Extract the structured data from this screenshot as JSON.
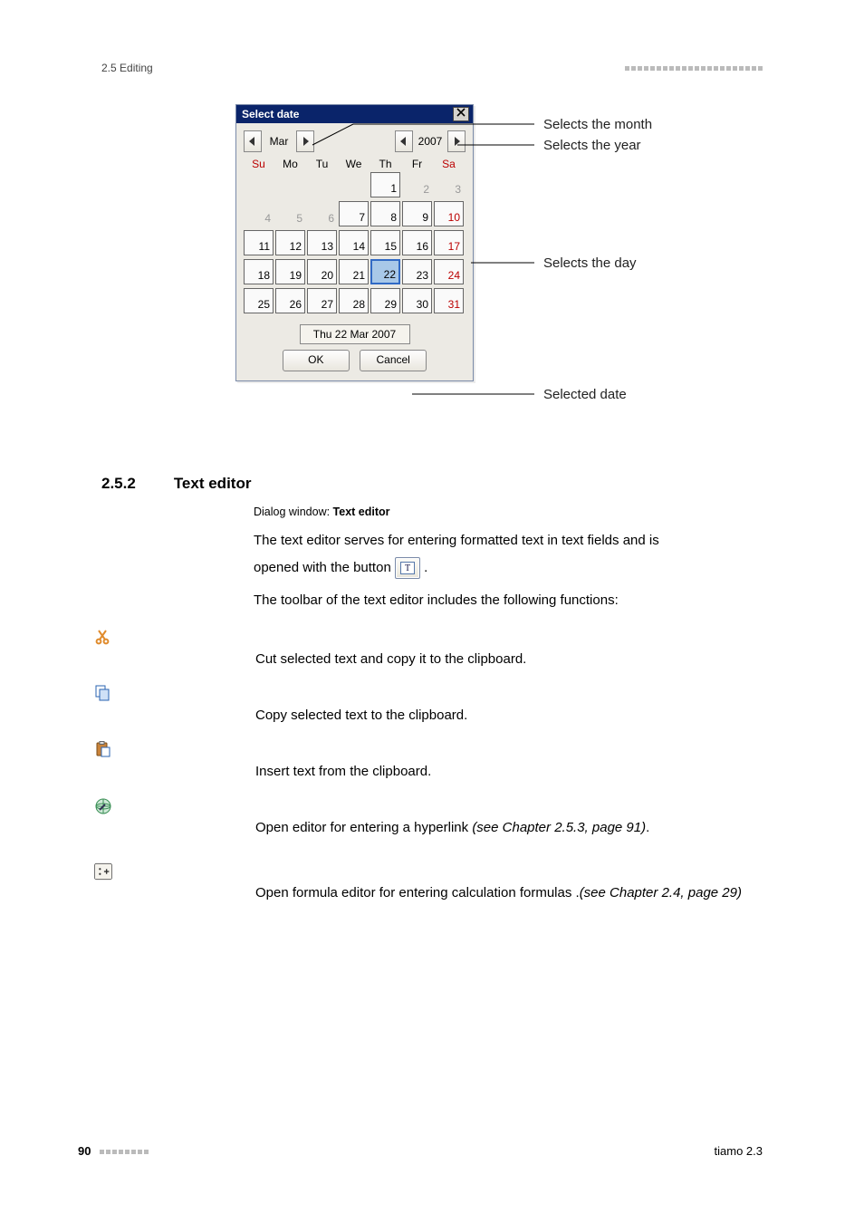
{
  "header": {
    "section_label": "2.5 Editing"
  },
  "dialog": {
    "title": "Select date",
    "month": "Mar",
    "year": "2007",
    "dow": [
      "Su",
      "Mo",
      "Tu",
      "We",
      "Th",
      "Fr",
      "Sa"
    ],
    "weeks": [
      [
        {
          "n": "",
          "a": false,
          "we": false
        },
        {
          "n": "",
          "a": false,
          "we": false
        },
        {
          "n": "",
          "a": false,
          "we": false
        },
        {
          "n": "",
          "a": false,
          "we": false
        },
        {
          "n": "1",
          "a": true,
          "we": false
        },
        {
          "n": "2",
          "a": false,
          "we": false
        },
        {
          "n": "3",
          "a": false,
          "we": true
        }
      ],
      [
        {
          "n": "4",
          "a": false,
          "we": false
        },
        {
          "n": "5",
          "a": false,
          "we": false
        },
        {
          "n": "6",
          "a": false,
          "we": false
        },
        {
          "n": "7",
          "a": true,
          "we": false
        },
        {
          "n": "8",
          "a": true,
          "we": false
        },
        {
          "n": "9",
          "a": true,
          "we": false
        },
        {
          "n": "10",
          "a": true,
          "we": true
        }
      ],
      [
        {
          "n": "11",
          "a": true,
          "we": false
        },
        {
          "n": "12",
          "a": true,
          "we": false
        },
        {
          "n": "13",
          "a": true,
          "we": false
        },
        {
          "n": "14",
          "a": true,
          "we": false
        },
        {
          "n": "15",
          "a": true,
          "we": false
        },
        {
          "n": "16",
          "a": true,
          "we": false
        },
        {
          "n": "17",
          "a": true,
          "we": true
        }
      ],
      [
        {
          "n": "18",
          "a": true,
          "we": false
        },
        {
          "n": "19",
          "a": true,
          "we": false
        },
        {
          "n": "20",
          "a": true,
          "we": false
        },
        {
          "n": "21",
          "a": true,
          "we": false
        },
        {
          "n": "22",
          "a": true,
          "we": false,
          "sel": true
        },
        {
          "n": "23",
          "a": true,
          "we": false
        },
        {
          "n": "24",
          "a": true,
          "we": true
        }
      ],
      [
        {
          "n": "25",
          "a": true,
          "we": false
        },
        {
          "n": "26",
          "a": true,
          "we": false
        },
        {
          "n": "27",
          "a": true,
          "we": false
        },
        {
          "n": "28",
          "a": true,
          "we": false
        },
        {
          "n": "29",
          "a": true,
          "we": false
        },
        {
          "n": "30",
          "a": true,
          "we": false
        },
        {
          "n": "31",
          "a": true,
          "we": true
        }
      ]
    ],
    "selected_date_display": "Thu  22 Mar 2007",
    "ok_label": "OK",
    "cancel_label": "Cancel"
  },
  "callouts": {
    "month": "Selects the month",
    "year": "Selects the year",
    "day": "Selects the day",
    "selected": "Selected date"
  },
  "section": {
    "number": "2.5.2",
    "title": "Text editor"
  },
  "body": {
    "dialog_caption_prefix": "Dialog window: ",
    "dialog_caption_name": "Text editor",
    "para1a": "The text editor serves for entering formatted text in text fields and is",
    "para1b_pre": "opened with the button ",
    "para1b_post": ".",
    "para2": "The toolbar of the text editor includes the following functions:"
  },
  "tools": {
    "cut": "Cut selected text and copy it to the clipboard.",
    "copy": "Copy selected text to the clipboard.",
    "paste": "Insert text from the clipboard.",
    "link_pre": "Open editor for entering a hyperlink ",
    "link_ref": "(see Chapter 2.5.3, page 91)",
    "link_post": ".",
    "formula_pre": "Open formula editor for entering calculation formulas .",
    "formula_ref": "(see Chapter 2.4, page 29)"
  },
  "footer": {
    "page": "90",
    "product": "tiamo 2.3"
  }
}
